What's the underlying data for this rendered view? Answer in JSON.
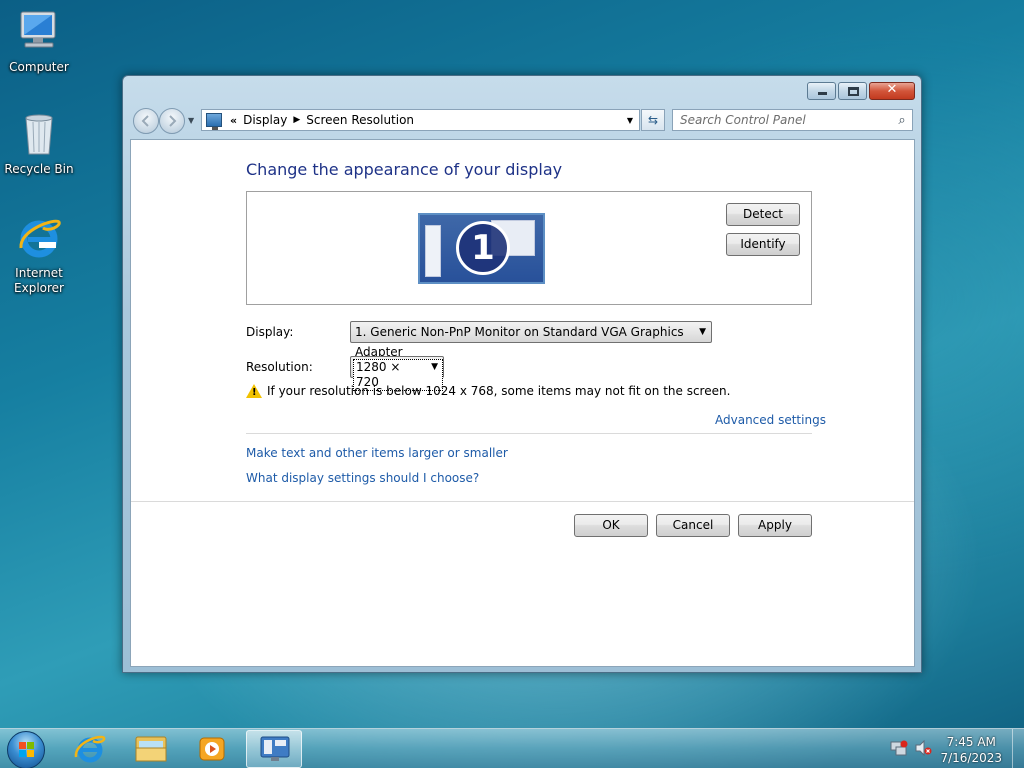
{
  "desktop": {
    "icons": [
      {
        "label": "Computer"
      },
      {
        "label": "Recycle Bin"
      },
      {
        "label": "Internet Explorer"
      }
    ]
  },
  "window": {
    "address": {
      "chevron": "«",
      "crumbs": [
        "Display",
        "Screen Resolution"
      ]
    },
    "search": {
      "placeholder": "Search Control Panel"
    },
    "heading": "Change the appearance of your display",
    "monitor_number": "1",
    "buttons": {
      "detect": "Detect",
      "identify": "Identify",
      "ok": "OK",
      "cancel": "Cancel",
      "apply": "Apply"
    },
    "display": {
      "label": "Display:",
      "value": "1. Generic Non-PnP Monitor on Standard VGA Graphics Adapter"
    },
    "resolution": {
      "label": "Resolution:",
      "value": "1280 × 720"
    },
    "warning": "If your resolution is below 1024 x 768, some items may not fit on the screen.",
    "links": {
      "advanced": "Advanced settings",
      "text_size": "Make text and other items larger or smaller",
      "help": "What display settings should I choose?"
    }
  },
  "taskbar": {
    "time": "7:45 AM",
    "date": "7/16/2023",
    "items": [
      "start-button",
      "internet-explorer",
      "windows-explorer",
      "media-player",
      "screen-resolution"
    ]
  },
  "colors": {
    "heading": "#1e3287",
    "link": "#1e5ba8",
    "close_button": "#c23a1f"
  }
}
